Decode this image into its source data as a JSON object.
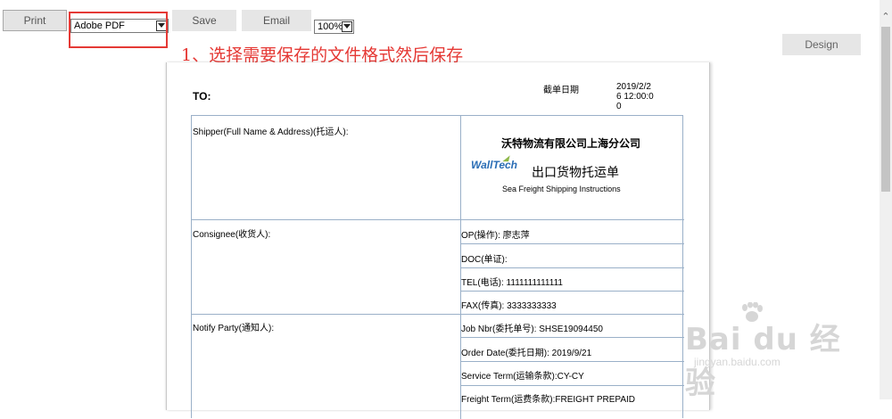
{
  "toolbar": {
    "print_label": "Print",
    "format_value": "Adobe PDF",
    "save_label": "Save",
    "email_label": "Email",
    "zoom_value": "100%",
    "design_label": "Design"
  },
  "annotation": {
    "text": "1、选择需要保存的文件格式然后保存",
    "color": "#e53935"
  },
  "document": {
    "to_label": "TO:",
    "cutoff_label": "截单日期",
    "cutoff_value": "2019/2/26 12:00:00",
    "company_name": "沃特物流有限公司上海分公司",
    "logo_text": "WallTech",
    "form_title": "出口货物托运单",
    "form_subtitle": "Sea Freight Shipping Instructions",
    "left_labels": {
      "shipper": "Shipper(Full Name & Address)(托运人):",
      "consignee": "Consignee(收货人):",
      "notify": "Notify Party(通知人):"
    },
    "right_fields": [
      "OP(操作): 廖志萍",
      "DOC(单证):",
      "TEL(电话): 1111111111111",
      "FAX(传真): 3333333333",
      "Job Nbr(委托单号): SHSE19094450",
      "Order Date(委托日期): 2019/9/21",
      "Service Term(运输条款):CY-CY",
      "Freight Term(运费条款):FREIGHT PREPAID"
    ]
  },
  "watermark": {
    "text": "Bai du 经验",
    "url_text": "jingyan.baidu.com"
  },
  "colors": {
    "accent_red": "#e53935",
    "table_border": "#9ab0c8",
    "logo_blue": "#2a6db5"
  }
}
